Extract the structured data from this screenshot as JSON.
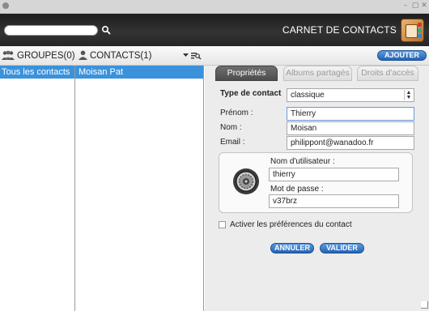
{
  "window": {
    "minimize_glyph": "–",
    "maximize_glyph": "▢",
    "close_glyph": "✕"
  },
  "header": {
    "search": {
      "value": "",
      "placeholder": ""
    },
    "title": "CARNET DE CONTACTS",
    "logo_icon": "contacts-book-icon",
    "search_icon": "magnifier-icon"
  },
  "toolbar": {
    "groups_label": "GROUPES(0)",
    "contacts_label": "CONTACTS(1)",
    "add_label": "AJOUTER",
    "groups_icon": "group-people-icon",
    "contacts_icon": "person-icon",
    "sort_icon": "sort-filter-icon"
  },
  "groups": {
    "items": [
      {
        "label": "Tous les contacts",
        "selected": true
      }
    ]
  },
  "contacts": {
    "items": [
      {
        "label": "Moisan Pat",
        "selected": true
      }
    ]
  },
  "details": {
    "tabs": [
      {
        "label": "Propriétés",
        "active": true
      },
      {
        "label": "Albums partagés",
        "active": false
      },
      {
        "label": "Droits d'accès",
        "active": false
      }
    ],
    "type_label": "Type de contact",
    "type_value": "classique",
    "prenom_label": "Prénom :",
    "prenom_value": "Thierry",
    "nom_label": "Nom :",
    "nom_value": "Moisan",
    "email_label": "Email :",
    "email_value": "philippont@wanadoo.fr",
    "login": {
      "icon": "safe-lock-icon",
      "username_label": "Nom d'utilisateur :",
      "username_value": "thierry",
      "password_label": "Mot de passe :",
      "password_value": "v37brz"
    },
    "prefs_label": "Activer les préférences du contact",
    "prefs_checked": false,
    "cancel_label": "ANNULER",
    "validate_label": "VALIDER"
  },
  "colors": {
    "accent_blue": "#3b92dc",
    "button_blue": "#2464b4",
    "header_dark": "#262626"
  }
}
